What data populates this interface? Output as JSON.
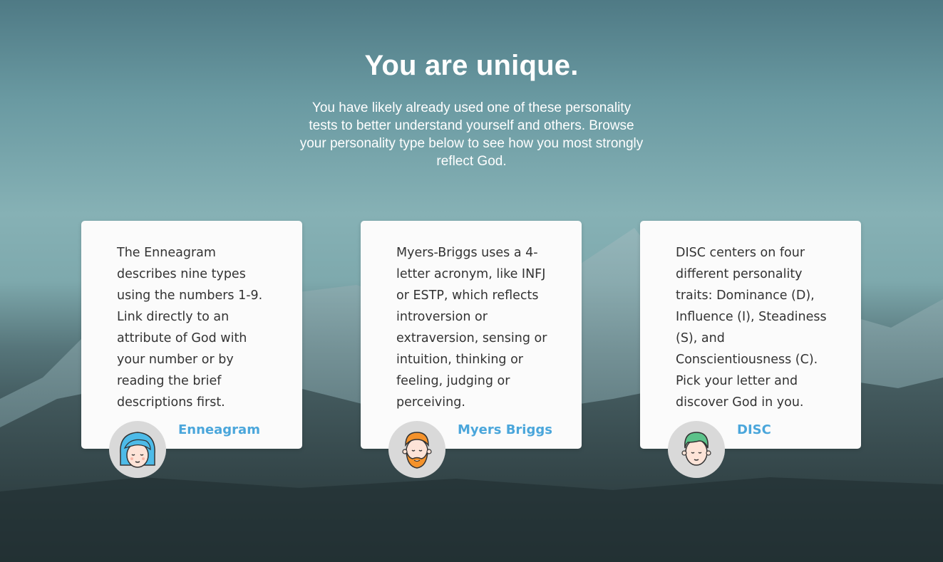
{
  "hero": {
    "title": "You are unique.",
    "subtitle": "You have likely already used one of these personality tests to better understand yourself and others. Browse your personality type below to see how you most strongly reflect God."
  },
  "cards": [
    {
      "description": "The Enneagram describes nine types using the numbers 1-9. Link directly to an attribute of God with your number or by reading the brief descriptions first.",
      "link_label": "Enneagram",
      "avatar_icon": "woman-blue-hair-icon"
    },
    {
      "description": "Myers-Briggs uses a 4-letter acronym, like INFJ or ESTP, which reflects introversion or extraversion, sensing or intuition, thinking or feeling, judging or perceiving.",
      "link_label": "Myers Briggs",
      "avatar_icon": "bearded-man-icon"
    },
    {
      "description": "DISC centers on four different personality traits: Dominance (D), Influence (I), Steadiness (S), and Conscientiousness (C). Pick your letter and discover God in you.",
      "link_label": "DISC",
      "avatar_icon": "man-green-hair-icon"
    }
  ],
  "colors": {
    "link": "#4aa6db",
    "card_bg": "#fbfbfb",
    "avatar_bg": "#d9d9d9"
  }
}
